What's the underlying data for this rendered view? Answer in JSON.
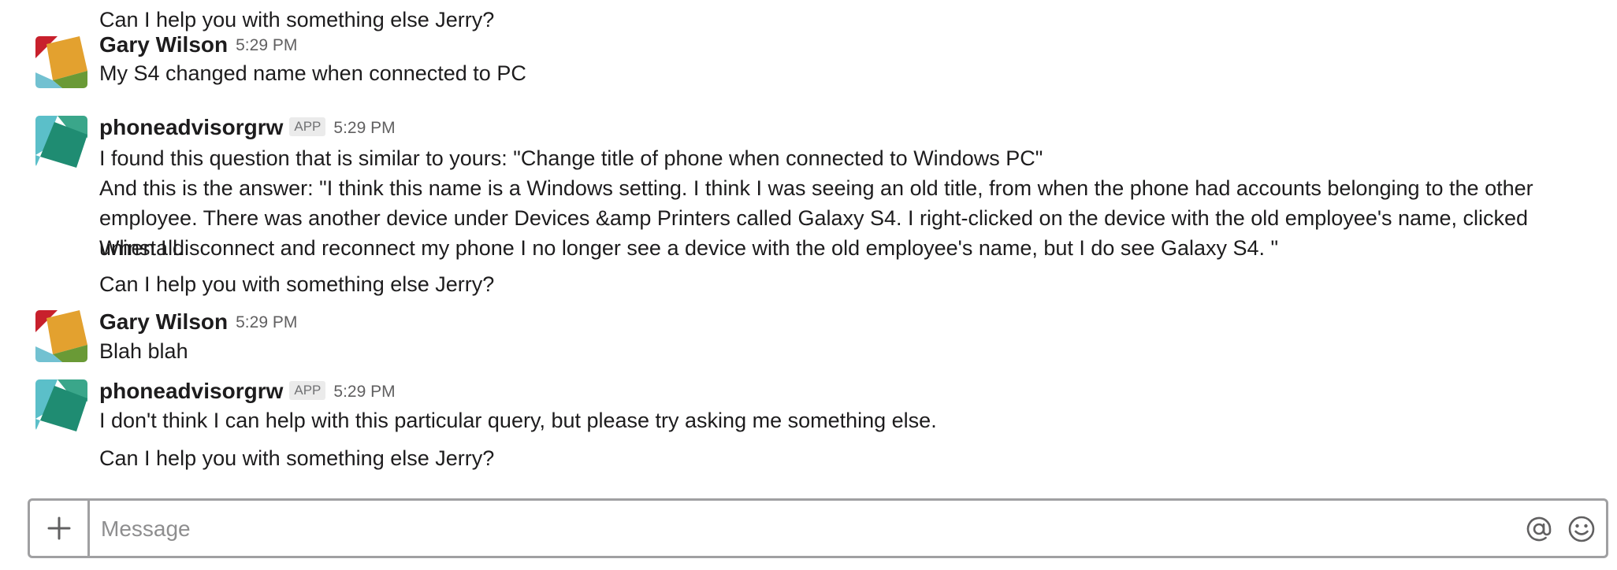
{
  "messages": [
    {
      "type": "continuation",
      "lines": [
        "Can I help you with something else Jerry?"
      ]
    },
    {
      "type": "message",
      "avatar": "user-avatar",
      "author": "Gary Wilson",
      "time": "5:29 PM",
      "lines": [
        "My S4 changed name when connected to PC"
      ]
    },
    {
      "type": "message",
      "avatar": "bot-avatar",
      "author": "phoneadvisorgrw",
      "badge": "APP",
      "time": "5:29 PM",
      "lines": [
        "I found this question that is similar to yours: \"Change title of phone when connected to Windows PC\"",
        "And this is the answer: \"I think this name is a Windows setting. I think I was seeing an old title, from when the phone had accounts belonging to the other",
        "employee. There was another device under Devices &amp Printers called Galaxy S4. I right-clicked on the device with the old employee's name, clicked uninstall.",
        "When I disconnect and reconnect my phone I no longer see a device with the old employee's name, but I do see Galaxy S4. \""
      ]
    },
    {
      "type": "continuation",
      "lines": [
        "Can I help you with something else Jerry?"
      ]
    },
    {
      "type": "message",
      "avatar": "user-avatar",
      "author": "Gary Wilson",
      "time": "5:29 PM",
      "lines": [
        "Blah blah"
      ]
    },
    {
      "type": "message",
      "avatar": "bot-avatar",
      "author": "phoneadvisorgrw",
      "badge": "APP",
      "time": "5:29 PM",
      "lines": [
        "I don't think I can help with this particular query, but please try asking me something else."
      ]
    },
    {
      "type": "continuation",
      "lines": [
        "Can I help you with something else Jerry?"
      ]
    }
  ],
  "composer": {
    "placeholder": "Message",
    "value": "",
    "icons": {
      "attach": "plus-icon",
      "mention": "at-sign-icon",
      "emoji": "smiley-icon"
    }
  },
  "colors": {
    "user_avatar": [
      "#c8202c",
      "#e3a12f",
      "#6a9a36",
      "#72c1d1"
    ],
    "bot_avatar": [
      "#5bbfc9",
      "#3aa68a",
      "#1f8c72"
    ]
  }
}
